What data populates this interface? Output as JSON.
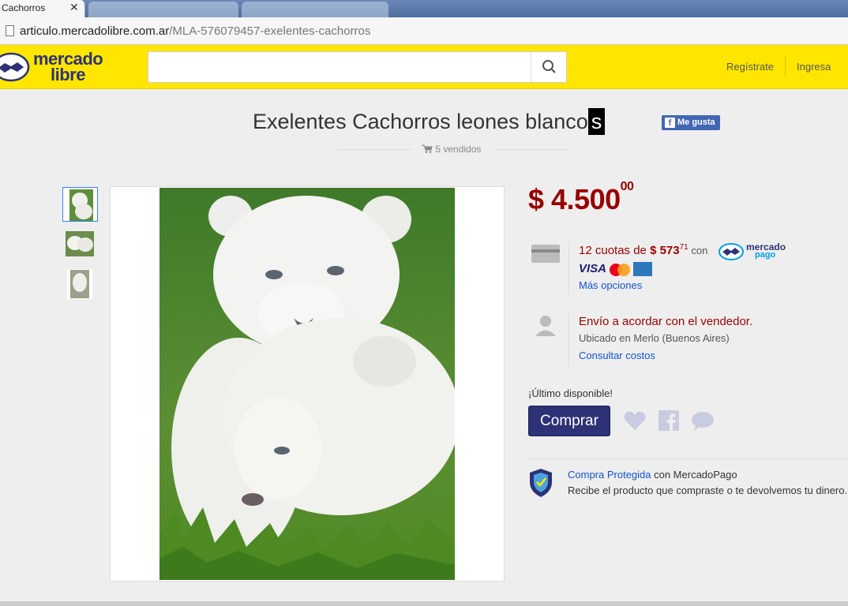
{
  "browser": {
    "active_tab_title": "Cachorros",
    "url_host": "articulo.mercadolibre.com.ar",
    "url_path": "/MLA-576079457-exelentes-cachorros"
  },
  "header": {
    "logo_line1": "mercado",
    "logo_line2": "libre",
    "search_value": "",
    "register_label": "Regístrate",
    "login_label": "Ingresa"
  },
  "product": {
    "title_main": "Exelentes Cachorros  leones blanco",
    "title_cursor_char": "s",
    "like_label": "Me gusta",
    "sold_count": "5 vendidos",
    "price_integer": "$ 4.500",
    "price_cents": "00"
  },
  "payment": {
    "cuotas_prefix": "12 cuotas de ",
    "cuotas_amount": "$ 573",
    "cuotas_cents": "71",
    "cuotas_con": " con",
    "mp_logo_line1": "mercado",
    "mp_logo_line2": "pago",
    "visa_label": "VISA",
    "more_options": "Más opciones"
  },
  "shipping": {
    "envio": "Envío a acordar con el vendedor.",
    "ubicado": "Ubicado en Merlo (Buenos Aires)",
    "consultar": "Consultar costos"
  },
  "purchase": {
    "availability": "¡Último disponible!",
    "buy_label": "Comprar"
  },
  "protection": {
    "link_label": "Compra Protegida",
    "suffix": " con MercadoPago",
    "description": "Recibe el producto que compraste o te devolvemos tu dinero."
  },
  "colors": {
    "brand_yellow": "#ffe600",
    "brand_blue": "#2d3277",
    "price_red": "#990000",
    "link_blue": "#1155cc"
  }
}
